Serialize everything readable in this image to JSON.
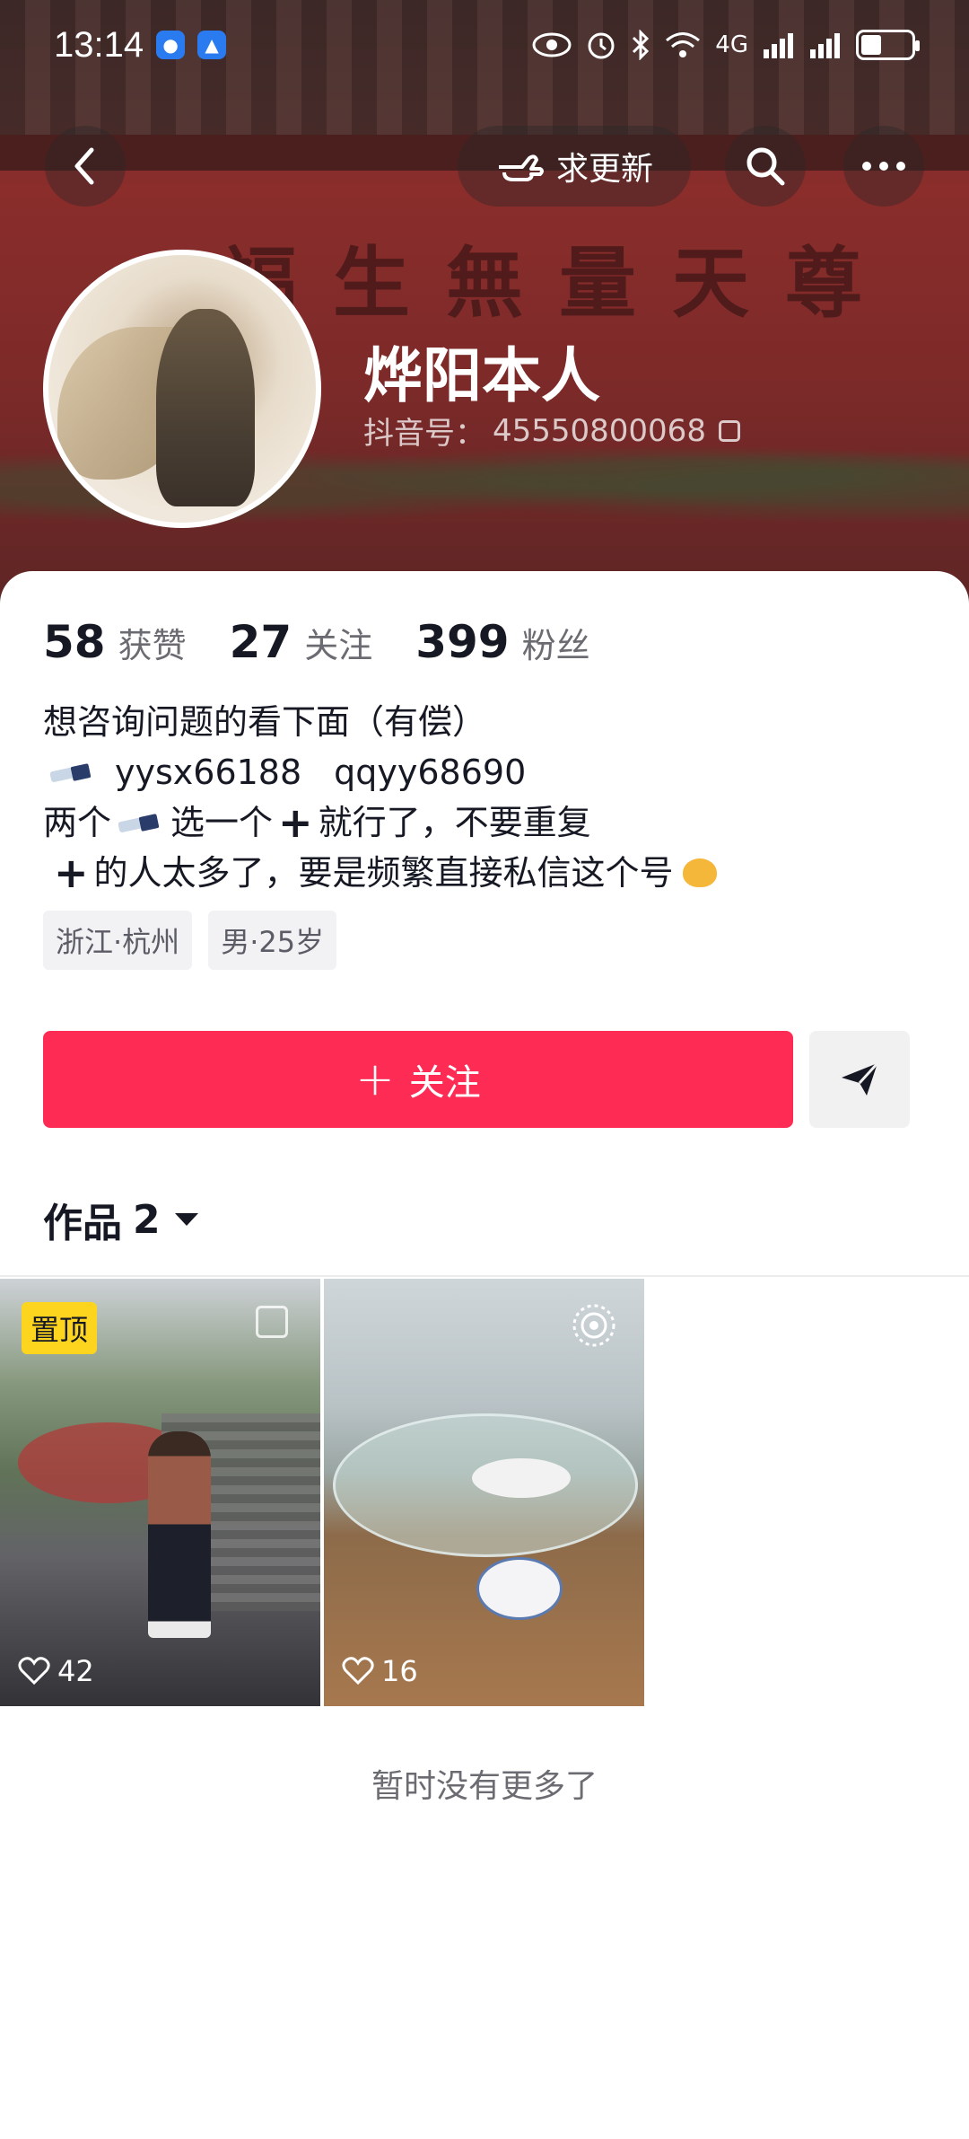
{
  "status_bar": {
    "time": "13:14",
    "network_label": "4G",
    "battery_percent": 40
  },
  "top_nav": {
    "update_label": "求更新"
  },
  "profile": {
    "name": "烨阳本人",
    "id_label": "抖音号：",
    "id_value": "45550800068",
    "cover_wall_text": "福生無量天尊"
  },
  "stats": [
    {
      "value": "58",
      "label": "获赞"
    },
    {
      "value": "27",
      "label": "关注"
    },
    {
      "value": "399",
      "label": "粉丝"
    }
  ],
  "bio": {
    "line1": "想咨询问题的看下面（有偿）",
    "line2_a": "yysx66188",
    "line2_b": "qqyy68690",
    "line3_a": "两个",
    "line3_b": "选一个",
    "line3_c": "就行了，不要重复",
    "line4_a": "的人太多了，要是频繁直接私信这个号"
  },
  "tags": [
    "浙江·杭州",
    "男·25岁"
  ],
  "actions": {
    "follow_label": "关注"
  },
  "works": {
    "label": "作品",
    "count": "2",
    "items": [
      {
        "pinned_label": "置顶",
        "likes": "42"
      },
      {
        "likes": "16"
      }
    ],
    "footer": "暂时没有更多了"
  },
  "colors": {
    "accent": "#fe2c55",
    "pinned": "#fdd41e"
  }
}
